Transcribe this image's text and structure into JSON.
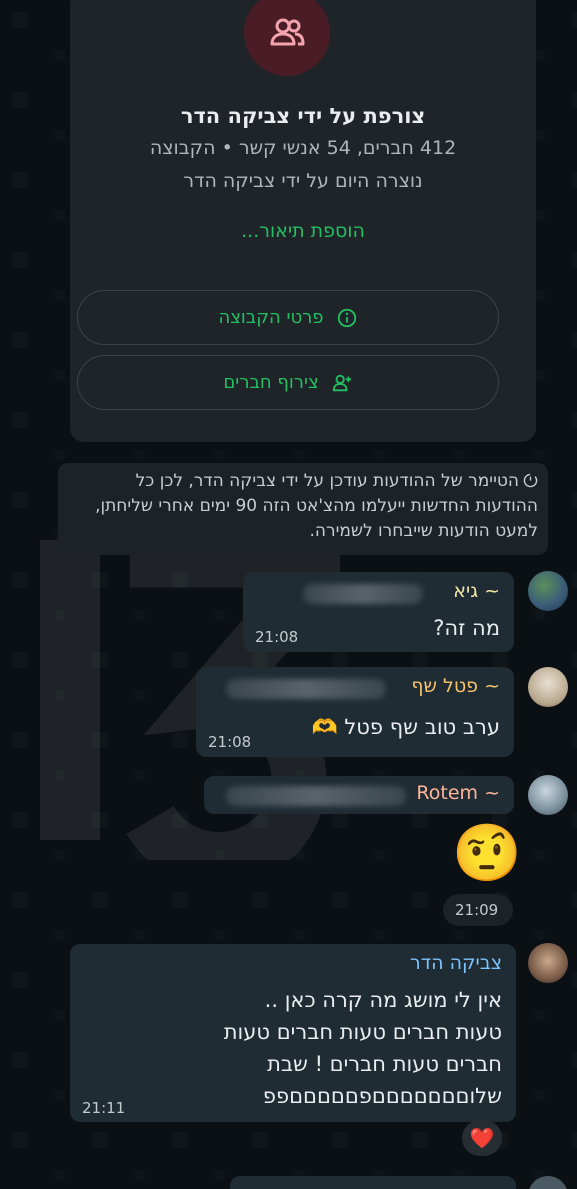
{
  "group_info": {
    "title": "צורפת על ידי צביקה הדר",
    "stats_line": "412 חברים, 54 אנשי קשר • הקבוצה",
    "created_line": "נוצרה היום על ידי צביקה הדר",
    "add_description": "הוספת תיאור...",
    "group_details_button": "פרטי הקבוצה",
    "add_members_button": "צירוף חברים",
    "avatar_icon": "group-icon",
    "accent_color": "#21c063"
  },
  "system_notice": {
    "text": "הטיימר של ההודעות עודכן על ידי צביקה הדר, לכן כל ההודעות החדשות ייעלמו מהצ'אט הזה 90 ימים אחרי שליחתן, למעט הודעות שייבחרו לשמירה.",
    "icon": "timer-icon"
  },
  "messages": [
    {
      "sender": "~ גיא",
      "sender_color": "#f0e6a8",
      "text": "מה זה?",
      "time": "21:08"
    },
    {
      "sender": "~ פטל שף",
      "sender_color": "#f5c26b",
      "text": "ערב טוב שף פטל 🫶",
      "time": "21:08"
    },
    {
      "sender": "~ Rotem",
      "sender_color": "#ffb59a",
      "emoji": "🤨",
      "time": "21:09"
    },
    {
      "sender": "צביקה הדר",
      "sender_color": "#7cc4ff",
      "lines": [
        "אין לי מושג מה קרה כאן ..",
        "טעות חברים טעות חברים טעות",
        "חברים  טעות חברים ! שבת",
        "שלוםםםםםםםפםםםםםפפ"
      ],
      "time": "21:11",
      "reaction": "❤️"
    }
  ]
}
